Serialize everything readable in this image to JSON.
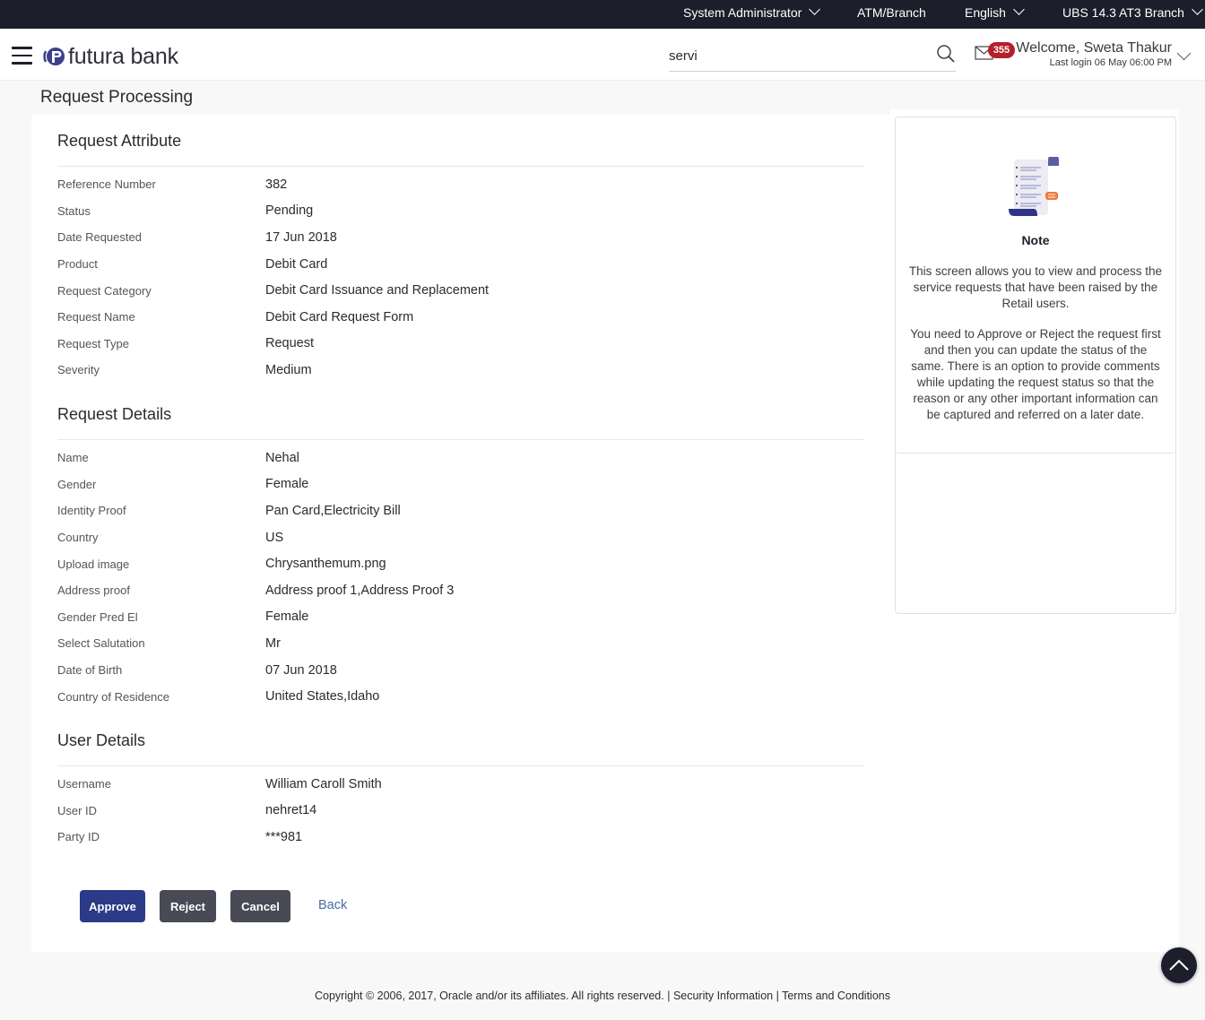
{
  "topbar": {
    "role": "System Administrator",
    "atm_branch": "ATM/Branch",
    "language": "English",
    "entity": "UBS 14.3 AT3 Branch"
  },
  "header": {
    "brand": "futura bank",
    "search_value": "servi",
    "mail_count": "355",
    "welcome": "Welcome, Sweta Thakur",
    "last_login": "Last login 06 May 06:00 PM"
  },
  "page": {
    "title": "Request Processing"
  },
  "sections": [
    {
      "title": "Request Attribute",
      "rows": [
        {
          "label": "Reference Number",
          "value": "382"
        },
        {
          "label": "Status",
          "value": "Pending"
        },
        {
          "label": "Date Requested",
          "value": "17 Jun 2018"
        },
        {
          "label": "Product",
          "value": "Debit Card"
        },
        {
          "label": "Request Category",
          "value": "Debit Card Issuance and Replacement"
        },
        {
          "label": "Request Name",
          "value": "Debit Card Request Form"
        },
        {
          "label": "Request Type",
          "value": "Request"
        },
        {
          "label": "Severity",
          "value": "Medium"
        }
      ]
    },
    {
      "title": "Request Details",
      "rows": [
        {
          "label": "Name",
          "value": "Nehal"
        },
        {
          "label": "Gender",
          "value": "Female"
        },
        {
          "label": "Identity Proof",
          "value": "Pan Card,Electricity Bill"
        },
        {
          "label": "Country",
          "value": "US"
        },
        {
          "label": "Upload image",
          "value": "Chrysanthemum.png"
        },
        {
          "label": "Address proof",
          "value": "Address proof 1,Address Proof 3"
        },
        {
          "label": "Gender Pred El",
          "value": "Female"
        },
        {
          "label": "Select Salutation",
          "value": "Mr"
        },
        {
          "label": "Date of Birth",
          "value": "07 Jun 2018"
        },
        {
          "label": "Country of Residence",
          "value": "United States,Idaho"
        }
      ]
    },
    {
      "title": "User Details",
      "rows": [
        {
          "label": "Username",
          "value": "William Caroll Smith"
        },
        {
          "label": "User ID",
          "value": "nehret14"
        },
        {
          "label": "Party ID",
          "value": "***981"
        }
      ]
    }
  ],
  "actions": {
    "approve": "Approve",
    "reject": "Reject",
    "cancel": "Cancel",
    "back": "Back"
  },
  "note": {
    "icon": "note-scroll-icon",
    "title": "Note",
    "paragraphs": [
      "This screen allows you to view and process the service requests that have been raised by the Retail users.",
      "You need to Approve or Reject the request first and then you can update the status of the same. There is an option to provide comments while updating the request status so that the reason or any other important information can be captured and referred on a later date."
    ]
  },
  "footer": {
    "copyright": "Copyright © 2006, 2017, Oracle and/or its affiliates. All rights reserved.",
    "separator": " | ",
    "security": "Security Information",
    "terms": "Terms and Conditions"
  },
  "colors": {
    "topbar": "#1c1f2b",
    "primary_button": "#2c3a87",
    "secondary_button": "#484b55",
    "badge": "#b3202a",
    "link": "#4a6aa8"
  }
}
